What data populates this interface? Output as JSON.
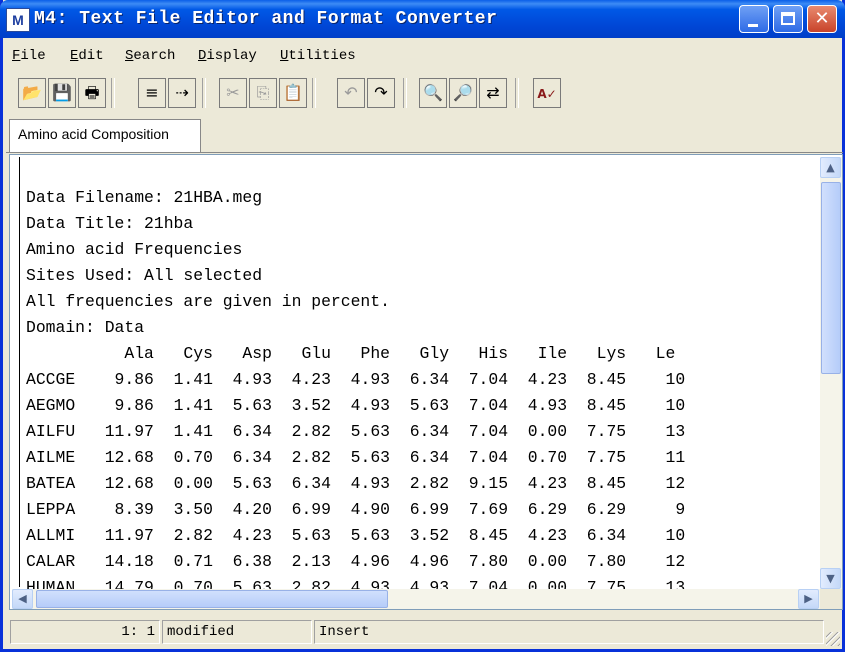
{
  "window": {
    "title": "M4: Text File Editor and Format Converter",
    "icon_letter": "M",
    "controls": [
      "minimize",
      "maximize",
      "close"
    ]
  },
  "menu": [
    "File",
    "Edit",
    "Search",
    "Display",
    "Utilities"
  ],
  "toolbar": [
    {
      "name": "open-icon",
      "glyph": "📂",
      "enabled": true
    },
    {
      "name": "save-icon",
      "glyph": "💾",
      "enabled": true
    },
    {
      "name": "print-icon",
      "glyph": "🖶",
      "enabled": true
    },
    {
      "name": "format-convert-icon",
      "glyph": "≡",
      "enabled": true
    },
    {
      "name": "open-converter-icon",
      "glyph": "⇢",
      "enabled": true
    },
    {
      "name": "cut-icon",
      "glyph": "✂",
      "enabled": false
    },
    {
      "name": "copy-icon",
      "glyph": "⎘",
      "enabled": false
    },
    {
      "name": "paste-icon",
      "glyph": "📋",
      "enabled": true
    },
    {
      "name": "undo-icon",
      "glyph": "↶",
      "enabled": false
    },
    {
      "name": "redo-icon",
      "glyph": "↷",
      "enabled": true
    },
    {
      "name": "find-icon",
      "glyph": "🔍",
      "enabled": true
    },
    {
      "name": "find-next-icon",
      "glyph": "🔎",
      "enabled": true
    },
    {
      "name": "replace-icon",
      "glyph": "⇄",
      "enabled": true
    },
    {
      "name": "spell-check-icon",
      "glyph": "A✓",
      "enabled": true
    }
  ],
  "tab": {
    "label": "Amino acid Composition"
  },
  "document": {
    "header_lines": [
      "",
      "Data Filename: 21HBA.meg",
      "Data Title: 21hba",
      "Amino acid Frequencies",
      "Sites Used: All selected",
      "All frequencies are given in percent.",
      "Domain: Data"
    ],
    "columns": [
      "Ala",
      "Cys",
      "Asp",
      "Glu",
      "Phe",
      "Gly",
      "His",
      "Ile",
      "Lys",
      "Le"
    ],
    "rows": [
      {
        "name": "ACCGE",
        "values": [
          "9.86",
          "1.41",
          "4.93",
          "4.23",
          "4.93",
          "6.34",
          "7.04",
          "4.23",
          "8.45",
          "10"
        ]
      },
      {
        "name": "AEGMO",
        "values": [
          "9.86",
          "1.41",
          "5.63",
          "3.52",
          "4.93",
          "5.63",
          "7.04",
          "4.93",
          "8.45",
          "10"
        ]
      },
      {
        "name": "AILFU",
        "values": [
          "11.97",
          "1.41",
          "6.34",
          "2.82",
          "5.63",
          "6.34",
          "7.04",
          "0.00",
          "7.75",
          "13"
        ]
      },
      {
        "name": "AILME",
        "values": [
          "12.68",
          "0.70",
          "6.34",
          "2.82",
          "5.63",
          "6.34",
          "7.04",
          "0.70",
          "7.75",
          "11"
        ]
      },
      {
        "name": "BATEA",
        "values": [
          "12.68",
          "0.00",
          "5.63",
          "6.34",
          "4.93",
          "2.82",
          "9.15",
          "4.23",
          "8.45",
          "12"
        ]
      },
      {
        "name": "LEPPA",
        "values": [
          "8.39",
          "3.50",
          "4.20",
          "6.99",
          "4.90",
          "6.99",
          "7.69",
          "6.29",
          "6.29",
          "9"
        ]
      },
      {
        "name": "ALLMI",
        "values": [
          "11.97",
          "2.82",
          "4.23",
          "5.63",
          "5.63",
          "3.52",
          "8.45",
          "4.23",
          "6.34",
          "10"
        ]
      },
      {
        "name": "CALAR",
        "values": [
          "14.18",
          "0.71",
          "6.38",
          "2.13",
          "4.96",
          "4.96",
          "7.80",
          "0.00",
          "7.80",
          "12"
        ]
      },
      {
        "name": "HUMAN",
        "values": [
          "14.79",
          "0.70",
          "5.63",
          "2.82",
          "4.93",
          "4.93",
          "7.04",
          "0.00",
          "7.75",
          "13"
        ]
      }
    ]
  },
  "status": {
    "position": "1: 1",
    "modified": "modified",
    "mode": "Insert"
  },
  "colors": {
    "title_bar": "#0054E3",
    "close_button": "#C8432A",
    "window_bg": "#ECE9D8"
  }
}
